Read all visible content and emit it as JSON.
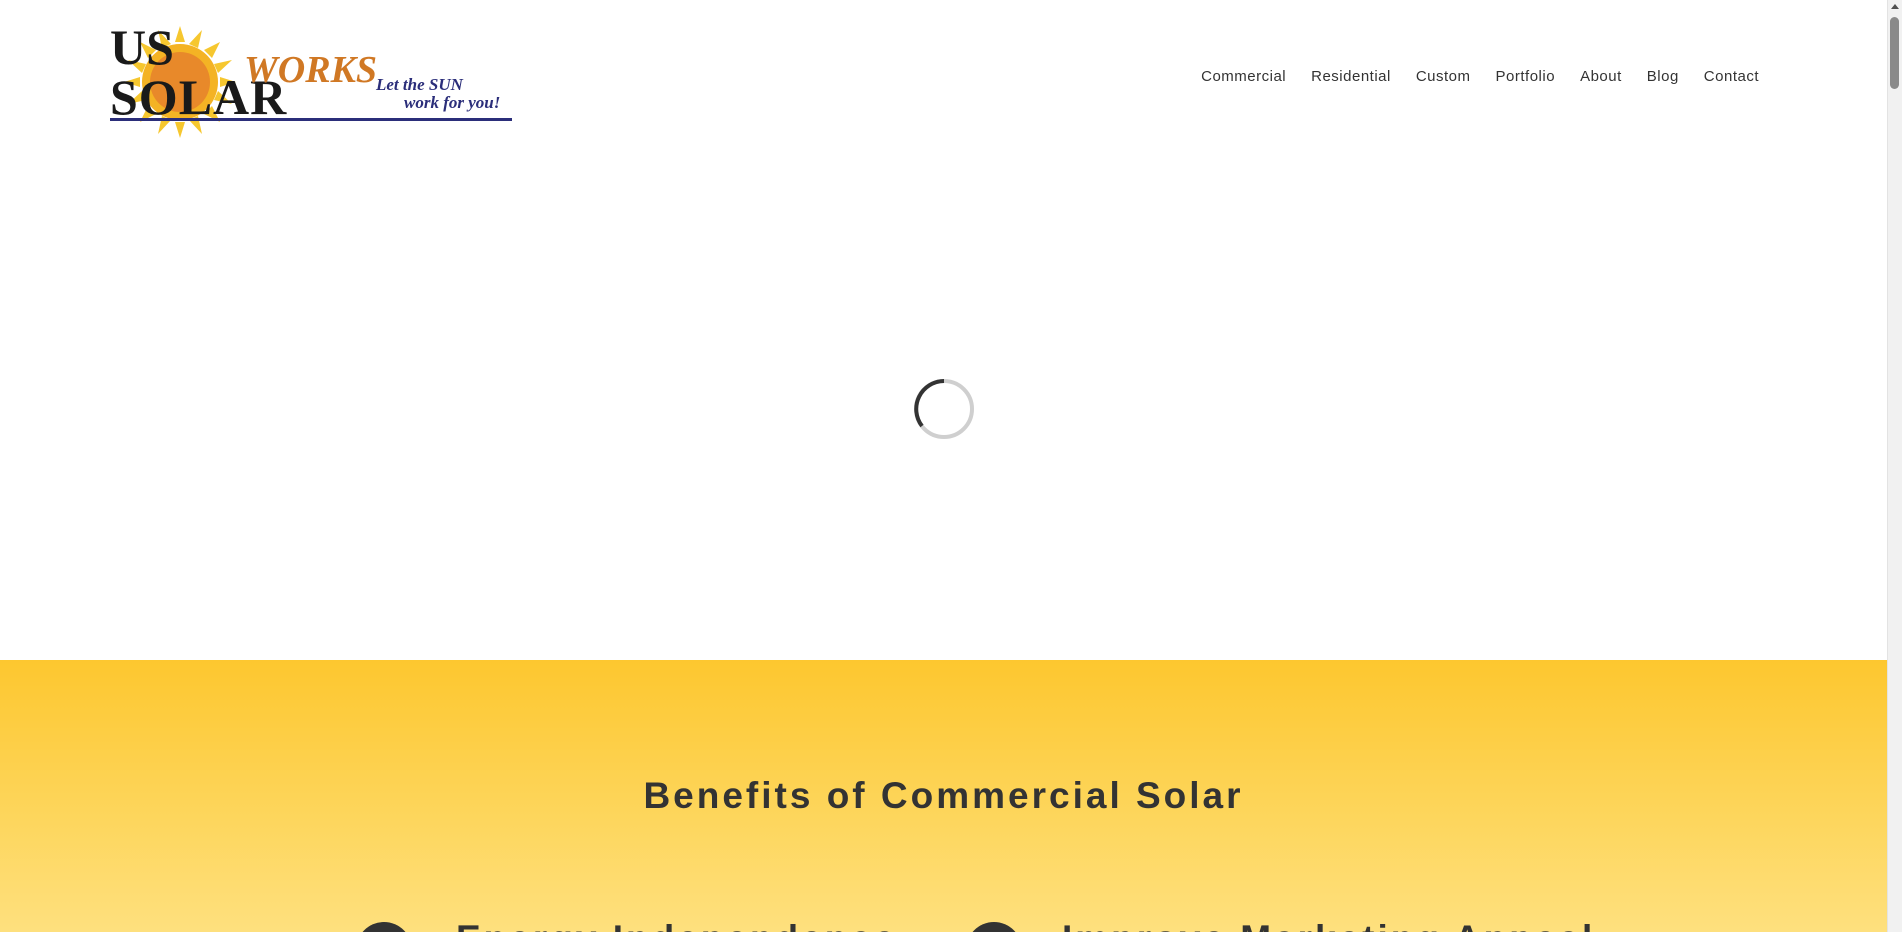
{
  "brand": {
    "logo_us": "US",
    "logo_solar": "SOLAR",
    "logo_works": "WORKS",
    "logo_tagline_1": "Let the SUN",
    "logo_tagline_2": "work for you!"
  },
  "nav": {
    "items": [
      {
        "label": "Commercial"
      },
      {
        "label": "Residential"
      },
      {
        "label": "Custom"
      },
      {
        "label": "Portfolio"
      },
      {
        "label": "About"
      },
      {
        "label": "Blog"
      },
      {
        "label": "Contact"
      }
    ]
  },
  "hero": {
    "spinner_icon": "loading-spinner-icon"
  },
  "benefits": {
    "title": "Benefits of Commercial Solar",
    "items": [
      {
        "label": "Energy Independence"
      },
      {
        "label": "Improve Marketing Appeal"
      }
    ]
  },
  "colors": {
    "accent_yellow": "#fdc72f",
    "text_dark": "#333333",
    "logo_orange": "#e8892a",
    "logo_navy": "#2b2e7a"
  }
}
